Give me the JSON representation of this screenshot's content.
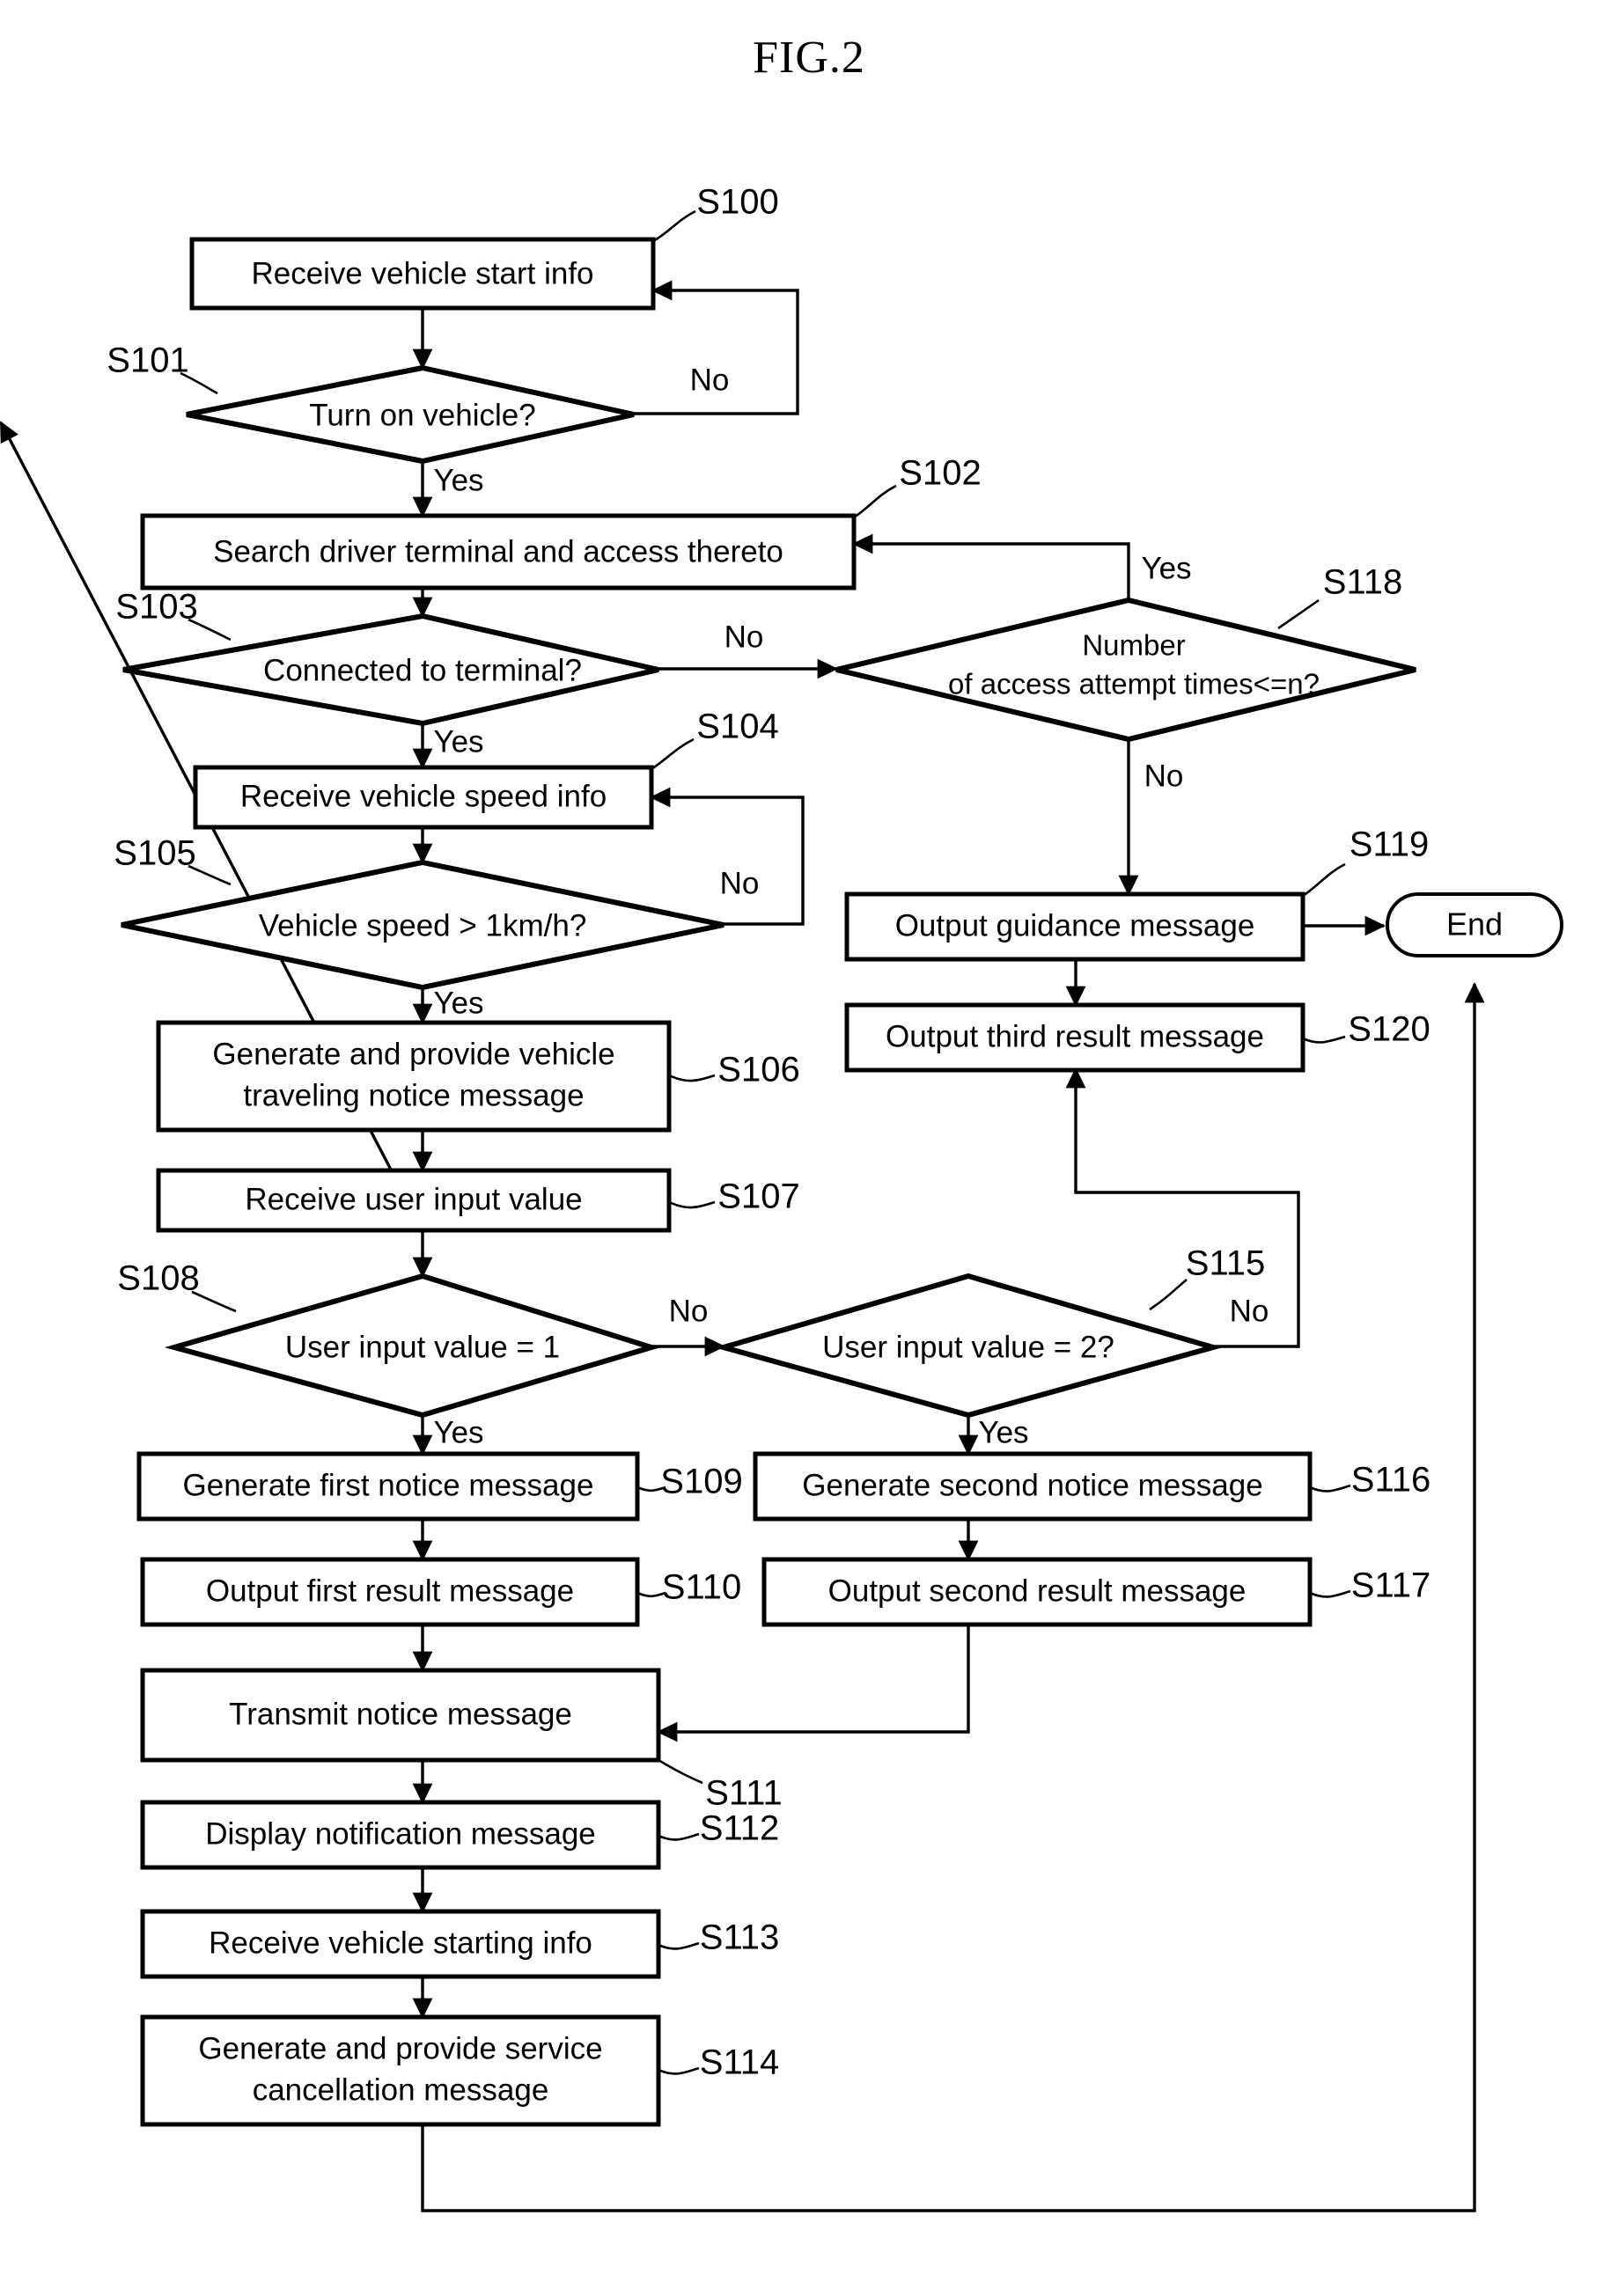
{
  "figure": {
    "title": "FIG.2"
  },
  "nodes": [
    {
      "id": "S100",
      "ref": "S100",
      "type": "process",
      "lines": [
        "Receive vehicle start info"
      ]
    },
    {
      "id": "S101",
      "ref": "S101",
      "type": "decision",
      "lines": [
        "Turn on vehicle?"
      ]
    },
    {
      "id": "S102",
      "ref": "S102",
      "type": "process",
      "lines": [
        "Search driver terminal and access thereto"
      ]
    },
    {
      "id": "S103",
      "ref": "S103",
      "type": "decision",
      "lines": [
        "Connected to terminal?"
      ]
    },
    {
      "id": "S104",
      "ref": "S104",
      "type": "process",
      "lines": [
        "Receive vehicle speed info"
      ]
    },
    {
      "id": "S105",
      "ref": "S105",
      "type": "decision",
      "lines": [
        "Vehicle speed > 1km/h?"
      ]
    },
    {
      "id": "S106",
      "ref": "S106",
      "type": "process",
      "lines": [
        "Generate and provide vehicle",
        "traveling notice message"
      ]
    },
    {
      "id": "S107",
      "ref": "S107",
      "type": "process",
      "lines": [
        "Receive user input value"
      ]
    },
    {
      "id": "S108",
      "ref": "S108",
      "type": "decision",
      "lines": [
        "User input value = 1"
      ]
    },
    {
      "id": "S109",
      "ref": "S109",
      "type": "process",
      "lines": [
        "Generate first notice message"
      ]
    },
    {
      "id": "S110",
      "ref": "S110",
      "type": "process",
      "lines": [
        "Output first result message"
      ]
    },
    {
      "id": "S111",
      "ref": "S111",
      "type": "process",
      "lines": [
        "Transmit notice message"
      ]
    },
    {
      "id": "S112",
      "ref": "S112",
      "type": "process",
      "lines": [
        "Display notification message"
      ]
    },
    {
      "id": "S113",
      "ref": "S113",
      "type": "process",
      "lines": [
        "Receive vehicle starting info"
      ]
    },
    {
      "id": "S114",
      "ref": "S114",
      "type": "process",
      "lines": [
        "Generate and provide service",
        "cancellation message"
      ]
    },
    {
      "id": "S115",
      "ref": "S115",
      "type": "decision",
      "lines": [
        "User input value = 2?"
      ]
    },
    {
      "id": "S116",
      "ref": "S116",
      "type": "process",
      "lines": [
        "Generate second notice message"
      ]
    },
    {
      "id": "S117",
      "ref": "S117",
      "type": "process",
      "lines": [
        "Output second result message"
      ]
    },
    {
      "id": "S118",
      "ref": "S118",
      "type": "decision",
      "lines": [
        "Number",
        "of access attempt times<=n?"
      ]
    },
    {
      "id": "S119",
      "ref": "S119",
      "type": "process",
      "lines": [
        "Output guidance message"
      ]
    },
    {
      "id": "S120",
      "ref": "S120",
      "type": "process",
      "lines": [
        "Output third result message"
      ]
    },
    {
      "id": "END",
      "ref": "",
      "type": "terminal",
      "lines": [
        "End"
      ]
    }
  ],
  "edge_labels": {
    "s101_no": "No",
    "s101_yes": "Yes",
    "s103_no": "No",
    "s103_yes": "Yes",
    "s105_no": "No",
    "s105_yes": "Yes",
    "s108_no": "No",
    "s108_yes": "Yes",
    "s115_no": "No",
    "s115_yes": "Yes",
    "s118_yes": "Yes",
    "s118_no": "No"
  },
  "chart_data": {
    "type": "diagram",
    "title": "FIG.2",
    "subtype": "flowchart",
    "steps": [
      {
        "ref": "S100",
        "text": "Receive vehicle start info"
      },
      {
        "ref": "S101",
        "text": "Turn on vehicle?"
      },
      {
        "ref": "S102",
        "text": "Search driver terminal and access thereto"
      },
      {
        "ref": "S103",
        "text": "Connected to terminal?"
      },
      {
        "ref": "S104",
        "text": "Receive vehicle speed info"
      },
      {
        "ref": "S105",
        "text": "Vehicle speed > 1km/h?"
      },
      {
        "ref": "S106",
        "text": "Generate and provide vehicle traveling notice message"
      },
      {
        "ref": "S107",
        "text": "Receive user input value"
      },
      {
        "ref": "S108",
        "text": "User input value = 1"
      },
      {
        "ref": "S109",
        "text": "Generate first notice message"
      },
      {
        "ref": "S110",
        "text": "Output first result message"
      },
      {
        "ref": "S111",
        "text": "Transmit notice message"
      },
      {
        "ref": "S112",
        "text": "Display notification message"
      },
      {
        "ref": "S113",
        "text": "Receive vehicle starting info"
      },
      {
        "ref": "S114",
        "text": "Generate and provide service cancellation message"
      },
      {
        "ref": "S115",
        "text": "User input value = 2?"
      },
      {
        "ref": "S116",
        "text": "Generate second notice message"
      },
      {
        "ref": "S117",
        "text": "Output second result message"
      },
      {
        "ref": "S118",
        "text": "Number of access attempt times<=n?"
      },
      {
        "ref": "S119",
        "text": "Output guidance message"
      },
      {
        "ref": "S120",
        "text": "Output third result message"
      },
      {
        "ref": "End",
        "text": "End"
      }
    ],
    "edges": [
      {
        "from": "S100",
        "to": "S101",
        "label": ""
      },
      {
        "from": "S101",
        "to": "S100",
        "label": "No"
      },
      {
        "from": "S101",
        "to": "S102",
        "label": "Yes"
      },
      {
        "from": "S102",
        "to": "S103",
        "label": ""
      },
      {
        "from": "S103",
        "to": "S118",
        "label": "No"
      },
      {
        "from": "S103",
        "to": "S104",
        "label": "Yes"
      },
      {
        "from": "S118",
        "to": "S102",
        "label": "Yes"
      },
      {
        "from": "S118",
        "to": "S119",
        "label": "No"
      },
      {
        "from": "S119",
        "to": "End",
        "label": ""
      },
      {
        "from": "S119",
        "to": "S120",
        "label": ""
      },
      {
        "from": "S104",
        "to": "S105",
        "label": ""
      },
      {
        "from": "S105",
        "to": "S104",
        "label": "No"
      },
      {
        "from": "S105",
        "to": "S106",
        "label": "Yes"
      },
      {
        "from": "S106",
        "to": "S107",
        "label": ""
      },
      {
        "from": "S107",
        "to": "S108",
        "label": ""
      },
      {
        "from": "S108",
        "to": "S115",
        "label": "No"
      },
      {
        "from": "S108",
        "to": "S109",
        "label": "Yes"
      },
      {
        "from": "S115",
        "to": "S120",
        "label": "No"
      },
      {
        "from": "S115",
        "to": "S116",
        "label": "Yes"
      },
      {
        "from": "S109",
        "to": "S110",
        "label": ""
      },
      {
        "from": "S110",
        "to": "S111",
        "label": ""
      },
      {
        "from": "S116",
        "to": "S117",
        "label": ""
      },
      {
        "from": "S117",
        "to": "S111",
        "label": ""
      },
      {
        "from": "S111",
        "to": "S112",
        "label": ""
      },
      {
        "from": "S112",
        "to": "S113",
        "label": ""
      },
      {
        "from": "S113",
        "to": "S114",
        "label": ""
      },
      {
        "from": "S114",
        "to": "End",
        "label": ""
      }
    ]
  }
}
